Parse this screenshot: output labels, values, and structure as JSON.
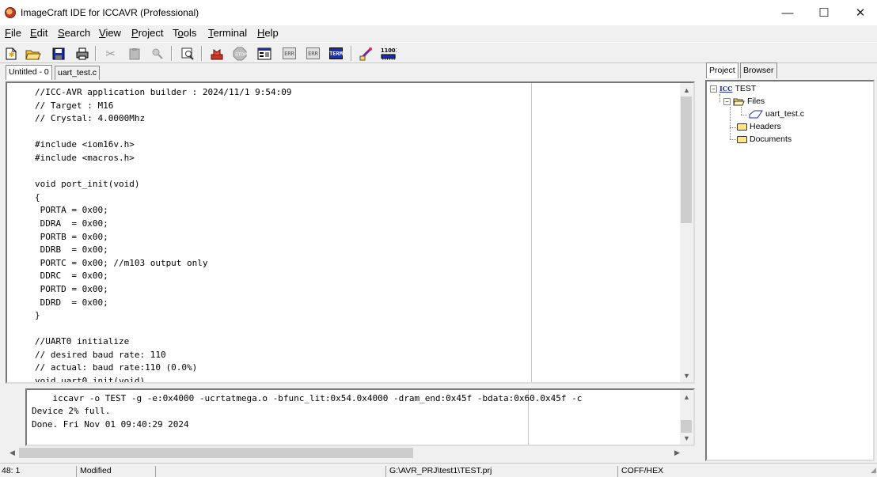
{
  "window": {
    "title": "ImageCraft IDE for ICCAVR (Professional)",
    "minimize": "—",
    "maximize": "☐",
    "close": "✕"
  },
  "menu": [
    {
      "u": "F",
      "rest": "ile"
    },
    {
      "u": "E",
      "rest": "dit"
    },
    {
      "u": "S",
      "rest": "earch"
    },
    {
      "u": "V",
      "rest": "iew"
    },
    {
      "u": "P",
      "rest": "roject"
    },
    {
      "pre": "T",
      "u": "o",
      "rest": "ols"
    },
    {
      "u": "T",
      "rest": "erminal"
    },
    {
      "u": "H",
      "rest": "elp"
    }
  ],
  "toolbar": {
    "icons": [
      "new-file-icon",
      "open-folder-icon",
      "save-icon",
      "print-icon",
      "cut-icon",
      "paste-icon",
      "find-replace-icon",
      "find-in-files-icon",
      "build-icon",
      "stop-icon",
      "app-builder-icon",
      "error-prev-icon",
      "error-next-icon",
      "terminal-icon",
      "program-chip-icon",
      "binary-icon"
    ],
    "err_label": "ERR",
    "term_label": "TERM",
    "binary_label": "11001"
  },
  "editor": {
    "tabs": [
      "Untitled - 0",
      "uart_test.c"
    ],
    "lines": [
      "//ICC-AVR application builder : 2024/11/1 9:54:09",
      "// Target : M16",
      "// Crystal: 4.0000Mhz",
      "",
      "#include <iom16v.h>",
      "#include <macros.h>",
      "",
      "void port_init(void)",
      "{",
      " PORTA = 0x00;",
      " DDRA  = 0x00;",
      " PORTB = 0x00;",
      " DDRB  = 0x00;",
      " PORTC = 0x00; //m103 output only",
      " DDRC  = 0x00;",
      " PORTD = 0x00;",
      " DDRD  = 0x00;",
      "}",
      "",
      "//UART0 initialize",
      "// desired baud rate: 110",
      "// actual: baud rate:110 (0.0%)",
      "void uart0_init(void)"
    ]
  },
  "output": {
    "lines": [
      "    iccavr -o TEST -g -e:0x4000 -ucrtatmega.o -bfunc_lit:0x54.0x4000 -dram_end:0x45f -bdata:0x60.0x45f -c",
      "Device 2% full.",
      "Done. Fri Nov 01 09:40:29 2024"
    ]
  },
  "panel": {
    "tabs": [
      "Project",
      "Browser"
    ],
    "project_name": "TEST",
    "project_icon_text": "ICC",
    "files_label": "Files",
    "file_item": "uart_test.c",
    "headers_label": "Headers",
    "documents_label": "Documents"
  },
  "status": {
    "position": "48: 1",
    "modified": "Modified",
    "path": "G:\\AVR_PRJ\\test1\\TEST.prj",
    "format": "COFF/HEX"
  }
}
